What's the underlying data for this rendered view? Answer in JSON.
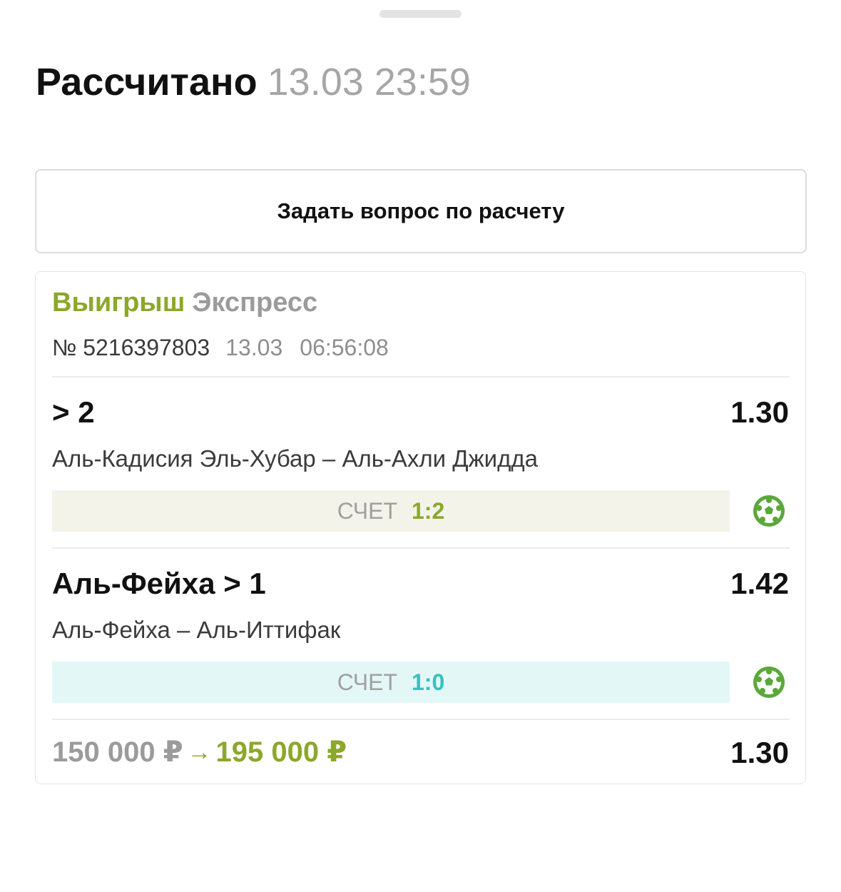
{
  "header": {
    "status": "Рассчитано",
    "datetime": "13.03 23:59"
  },
  "ask_button": {
    "label": "Задать вопрос по расчету"
  },
  "bet": {
    "result": "Выигрыш",
    "type": "Экспресс",
    "number": "№ 5216397803",
    "date": "13.03",
    "time": "06:56:08",
    "selections": [
      {
        "pick": "> 2",
        "odds": "1.30",
        "event": "Аль-Кадисия Эль-Хубар – Аль-Ахли Джидда",
        "score_label": "СЧЕТ",
        "score": "1:2",
        "sport_icon": "soccer-ball-icon"
      },
      {
        "pick": "Аль-Фейха > 1",
        "odds": "1.42",
        "event": "Аль-Фейха – Аль-Иттифак",
        "score_label": "СЧЕТ",
        "score": "1:0",
        "sport_icon": "soccer-ball-icon"
      }
    ],
    "stake": "150 000 ₽",
    "arrow": "→",
    "payout": "195 000 ₽",
    "total_odds": "1.30"
  },
  "colors": {
    "win_green": "#8ba82a",
    "score_teal": "#35c2bd",
    "ball_green": "#5aa83a",
    "muted": "#9b9b9b"
  }
}
